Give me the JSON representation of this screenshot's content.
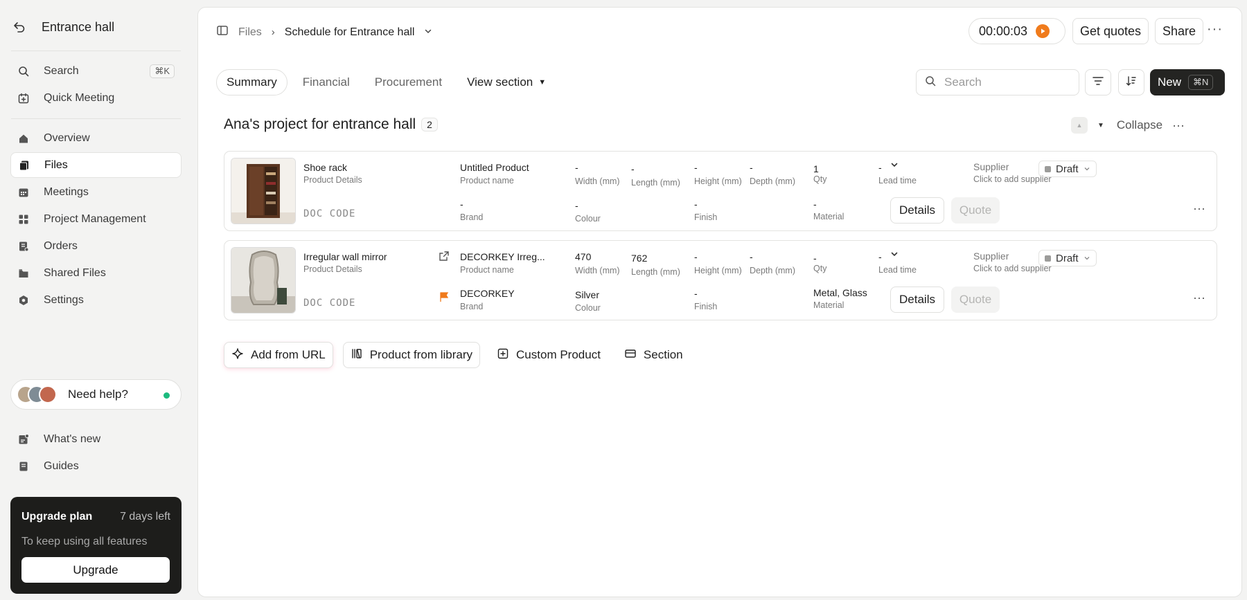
{
  "sidebar": {
    "project_title": "Entrance hall",
    "search": {
      "label": "Search",
      "shortcut": "⌘K"
    },
    "quick_meeting": "Quick Meeting",
    "items": [
      {
        "label": "Overview",
        "icon": "home-icon"
      },
      {
        "label": "Files",
        "icon": "files-icon",
        "active": true
      },
      {
        "label": "Meetings",
        "icon": "calendar-icon"
      },
      {
        "label": "Project Management",
        "icon": "grid-icon"
      },
      {
        "label": "Orders",
        "icon": "orders-icon"
      },
      {
        "label": "Shared Files",
        "icon": "shared-files-icon"
      },
      {
        "label": "Settings",
        "icon": "settings-icon"
      }
    ],
    "help": "Need help?",
    "whats_new": "What's new",
    "guides": "Guides",
    "upgrade": {
      "title": "Upgrade plan",
      "days_left": "7 days left",
      "subtitle": "To keep using all features",
      "button": "Upgrade"
    }
  },
  "header": {
    "breadcrumb_root": "Files",
    "breadcrumb_current": "Schedule for Entrance hall",
    "timer": "00:00:03",
    "get_quotes": "Get quotes",
    "share": "Share"
  },
  "toolbar": {
    "tabs": [
      "Summary",
      "Financial",
      "Procurement"
    ],
    "active_tab": "Summary",
    "view_section": "View section",
    "search_placeholder": "Search",
    "new_label": "New",
    "new_shortcut": "⌘N"
  },
  "section": {
    "title": "Ana's project for entrance hall",
    "count": "2",
    "collapse": "Collapse"
  },
  "rows": [
    {
      "item": "Shoe rack",
      "item_sub": "Product Details",
      "doc_code": "DOC CODE",
      "product_name": "Untitled Product",
      "product_name_label": "Product name",
      "brand": "-",
      "brand_label": "Brand",
      "width": "-",
      "width_label": "Width (mm)",
      "length": "-",
      "length_label": "Length (mm)",
      "height": "-",
      "height_label": "Height (mm)",
      "depth": "-",
      "depth_label": "Depth (mm)",
      "colour": "-",
      "colour_label": "Colour",
      "finish": "-",
      "finish_label": "Finish",
      "qty": "1",
      "qty_label": "Qty",
      "material": "-",
      "material_label": "Material",
      "lead_time": "-",
      "lead_time_label": "Lead time",
      "supplier_label": "Supplier",
      "supplier_hint": "Click to add supplier",
      "status": "Draft",
      "details": "Details",
      "quote": "Quote"
    },
    {
      "item": "Irregular wall mirror",
      "item_sub": "Product Details",
      "doc_code": "DOC CODE",
      "product_name": "DECORKEY Irreg...",
      "product_name_label": "Product name",
      "brand": "DECORKEY",
      "brand_label": "Brand",
      "width": "470",
      "width_label": "Width (mm)",
      "length": "762",
      "length_label": "Length (mm)",
      "height": "-",
      "height_label": "Height (mm)",
      "depth": "-",
      "depth_label": "Depth (mm)",
      "colour": "Silver",
      "colour_label": "Colour",
      "finish": "-",
      "finish_label": "Finish",
      "qty": "-",
      "qty_label": "Qty",
      "material": "Metal, Glass",
      "material_label": "Material",
      "lead_time": "-",
      "lead_time_label": "Lead time",
      "supplier_label": "Supplier",
      "supplier_hint": "Click to add supplier",
      "status": "Draft",
      "details": "Details",
      "quote": "Quote"
    }
  ],
  "add_actions": {
    "add_from_url": "Add from URL",
    "product_from_library": "Product from library",
    "custom_product": "Custom Product",
    "section": "Section"
  },
  "colors": {
    "accent_orange": "#f07b1c",
    "online_green": "#1dba7e",
    "dark_button": "#242422"
  }
}
